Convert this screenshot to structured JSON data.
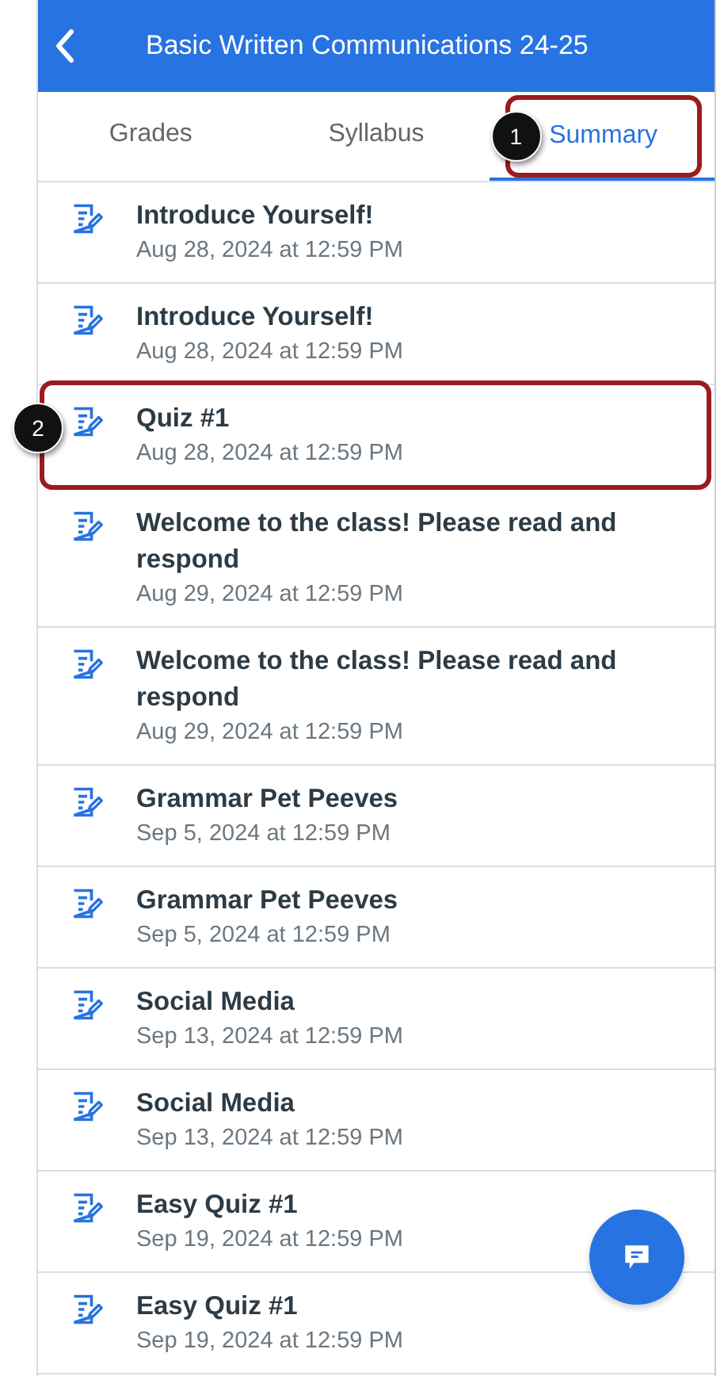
{
  "header": {
    "title": "Basic Written Communications 24-25"
  },
  "tabs": [
    {
      "label": "Grades",
      "selected": false
    },
    {
      "label": "Syllabus",
      "selected": false
    },
    {
      "label": "Summary",
      "selected": true,
      "callout": "1"
    }
  ],
  "items": [
    {
      "title": "Introduce Yourself!",
      "date": "Aug 28, 2024 at 12:59 PM"
    },
    {
      "title": "Introduce Yourself!",
      "date": "Aug 28, 2024 at 12:59 PM"
    },
    {
      "title": "Quiz #1",
      "date": "Aug 28, 2024 at 12:59 PM",
      "callout": "2"
    },
    {
      "title": "Welcome to the class! Please read and respond",
      "date": "Aug 29, 2024 at 12:59 PM"
    },
    {
      "title": "Welcome to the class! Please read and respond",
      "date": "Aug 29, 2024 at 12:59 PM"
    },
    {
      "title": "Grammar Pet Peeves",
      "date": "Sep 5, 2024 at 12:59 PM"
    },
    {
      "title": "Grammar Pet Peeves",
      "date": "Sep 5, 2024 at 12:59 PM"
    },
    {
      "title": "Social Media",
      "date": "Sep 13, 2024 at 12:59 PM"
    },
    {
      "title": "Social Media",
      "date": "Sep 13, 2024 at 12:59 PM"
    },
    {
      "title": "Easy Quiz #1",
      "date": "Sep 19, 2024 at 12:59 PM"
    },
    {
      "title": "Easy Quiz #1",
      "date": "Sep 19, 2024 at 12:59 PM"
    }
  ]
}
